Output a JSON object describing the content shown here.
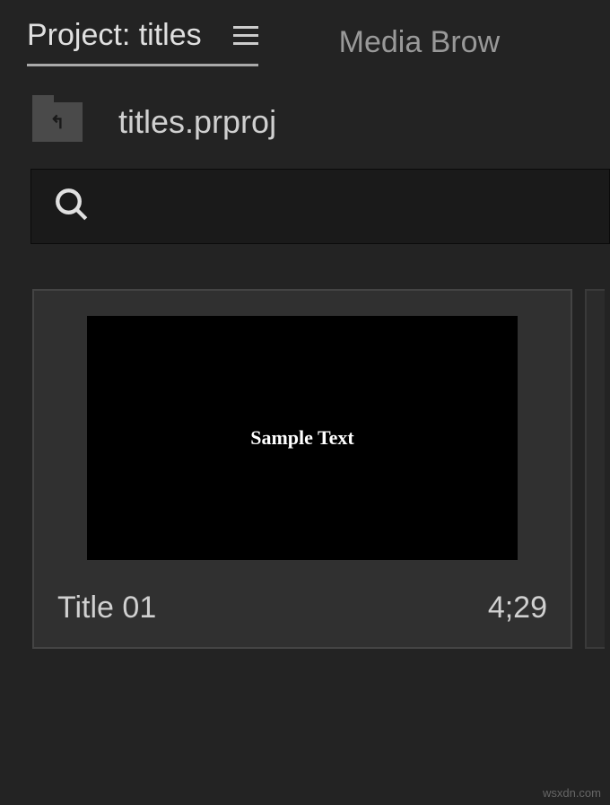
{
  "tabs": {
    "active": "Project: titles",
    "inactive": "Media Brow"
  },
  "project": {
    "filename": "titles.prproj"
  },
  "search": {
    "placeholder": ""
  },
  "bin": {
    "items": [
      {
        "name": "Title 01",
        "duration": "4;29",
        "preview_text": "Sample Text"
      }
    ]
  },
  "watermark": "wsxdn.com"
}
